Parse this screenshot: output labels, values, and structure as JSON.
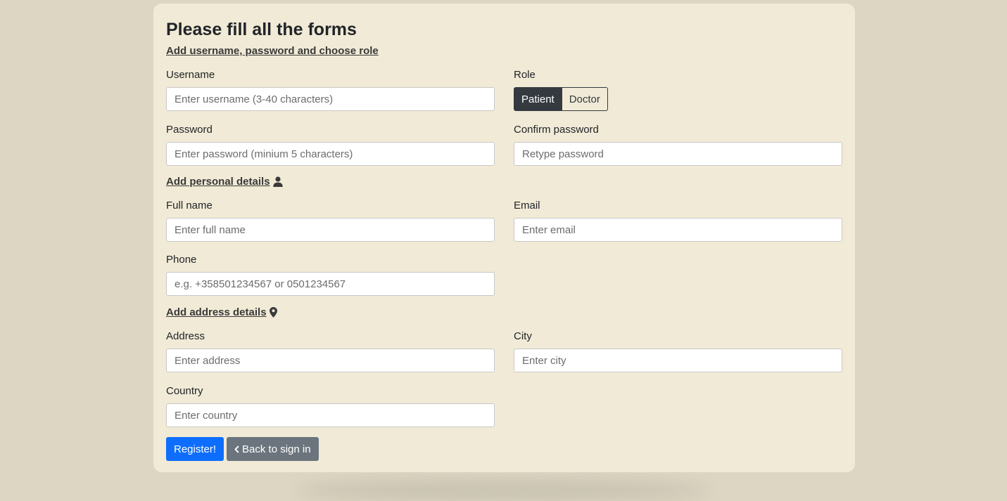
{
  "form": {
    "title": "Please fill all the forms",
    "section_account": "Add username, password and choose role",
    "section_personal": "Add personal details",
    "section_address": "Add address details",
    "username": {
      "label": "Username",
      "placeholder": "Enter username (3-40 characters)"
    },
    "role": {
      "label": "Role",
      "options": [
        "Patient",
        "Doctor"
      ],
      "selected": "Patient"
    },
    "password": {
      "label": "Password",
      "placeholder": "Enter password (minium 5 characters)"
    },
    "confirm_password": {
      "label": "Confirm password",
      "placeholder": "Retype password"
    },
    "full_name": {
      "label": "Full name",
      "placeholder": "Enter full name"
    },
    "email": {
      "label": "Email",
      "placeholder": "Enter email"
    },
    "phone": {
      "label": "Phone",
      "placeholder": "e.g. +358501234567 or 0501234567"
    },
    "address": {
      "label": "Address",
      "placeholder": "Enter address"
    },
    "city": {
      "label": "City",
      "placeholder": "Enter city"
    },
    "country": {
      "label": "Country",
      "placeholder": "Enter country"
    },
    "register_label": "Register!",
    "back_label": "Back to sign in"
  },
  "colors": {
    "page_bg": "#ddd6c3",
    "card_bg": "#f1ead6",
    "primary": "#0d6efd",
    "secondary": "#6c757d",
    "dark": "#343a40"
  },
  "icons": {
    "personal": "user-icon",
    "address": "map-pin-icon",
    "back": "chevron-left-icon"
  }
}
